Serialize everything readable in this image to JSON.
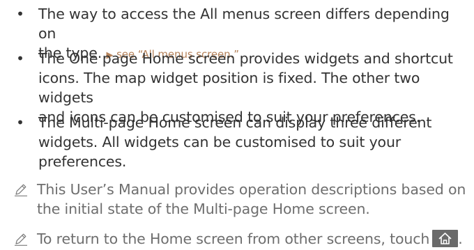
{
  "bullets": [
    {
      "lines": [
        "The way to access the All menus screen differs depending on",
        "the type."
      ],
      "ref": {
        "arrow": "▶",
        "text": "see “All menus screen.”"
      }
    },
    {
      "lines": [
        "The One page Home screen provides widgets and shortcut",
        "icons. The map widget position is fixed. The other two widgets",
        "and icons can be customised to suit your preferences."
      ]
    },
    {
      "lines": [
        "The Multi-page Home screen can display three different",
        "widgets. All widgets can be customised to suit your",
        "preferences."
      ]
    }
  ],
  "notes": [
    {
      "icon": "pencil-note-icon",
      "lines": [
        "This User’s Manual provides operation descriptions based on",
        "the initial state of the Multi-page Home screen."
      ]
    },
    {
      "icon": "pencil-note-icon",
      "text": "To return to the Home screen from other screens, touch",
      "button_icon": "home-icon",
      "end": "."
    }
  ],
  "colors": {
    "body_text": "#333333",
    "note_text": "#6e6e6e",
    "link": "#b5825a",
    "button_bg": "#6a6a6a"
  }
}
